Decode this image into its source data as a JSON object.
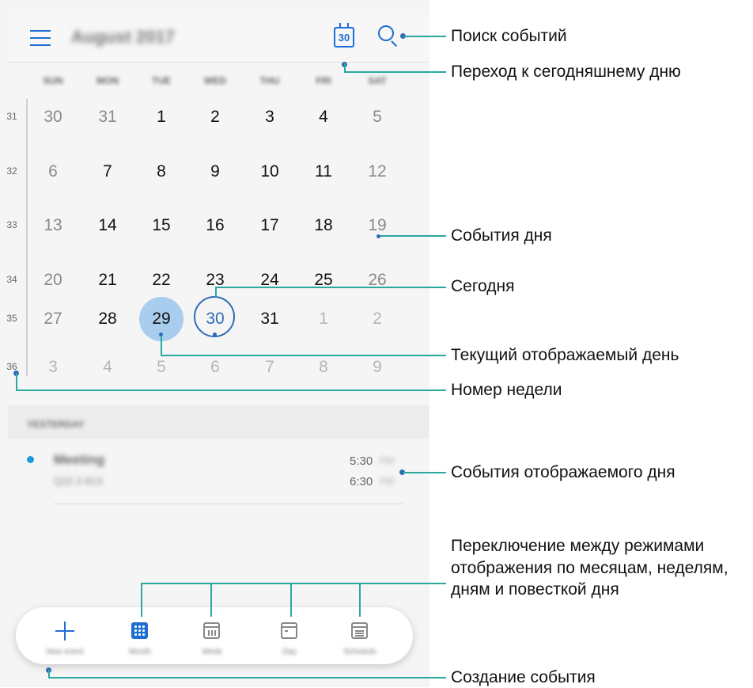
{
  "header": {
    "month_title": "August 2017",
    "today_button_number": "30"
  },
  "weekdays": [
    "SUN",
    "MON",
    "TUE",
    "WED",
    "THU",
    "FRI",
    "SAT"
  ],
  "calendar": {
    "weeks": [
      {
        "num": "31",
        "days": [
          "30",
          "31",
          "1",
          "2",
          "3",
          "4",
          "5"
        ]
      },
      {
        "num": "32",
        "days": [
          "6",
          "7",
          "8",
          "9",
          "10",
          "11",
          "12"
        ]
      },
      {
        "num": "33",
        "days": [
          "13",
          "14",
          "15",
          "16",
          "17",
          "18",
          "19"
        ]
      },
      {
        "num": "34",
        "days": [
          "20",
          "21",
          "22",
          "23",
          "24",
          "25",
          "26"
        ]
      },
      {
        "num": "35",
        "days": [
          "27",
          "28",
          "29",
          "30",
          "31",
          "1",
          "2"
        ]
      },
      {
        "num": "36",
        "days": [
          "3",
          "4",
          "5",
          "6",
          "7",
          "8",
          "9"
        ]
      }
    ],
    "selected_day": "29",
    "today": "30"
  },
  "events_section": {
    "header": "YESTERDAY",
    "event": {
      "title": "Meeting",
      "location": "Q22 2-813",
      "start": "5:30",
      "end": "6:30",
      "start_ampm": "PM",
      "end_ampm": "PM",
      "color": "#1a9de0"
    }
  },
  "bottom_bar": {
    "tabs": [
      {
        "label": "New event",
        "icon": "plus-icon"
      },
      {
        "label": "Month",
        "icon": "month-grid-icon"
      },
      {
        "label": "Week",
        "icon": "week-calendar-icon"
      },
      {
        "label": "Day",
        "icon": "day-calendar-icon"
      },
      {
        "label": "Schedule",
        "icon": "schedule-calendar-icon"
      }
    ]
  },
  "annotations": {
    "search": "Поиск событий",
    "today_jump": "Переход к сегодняшнему дню",
    "day_events": "События дня",
    "today": "Сегодня",
    "current_day": "Текущий отображаемый день",
    "week_number": "Номер недели",
    "displayed_day_events": "События отображаемого дня",
    "switch_views": "Переключение между режимами отображения по месяцам, неделям, дням и повесткой дня",
    "create_event": "Создание события"
  },
  "colors": {
    "accent": "#1f6ed4",
    "selected_fill": "#a8cdee",
    "today_ring": "#2e6bb5",
    "callout_line": "#2aa8a0"
  }
}
